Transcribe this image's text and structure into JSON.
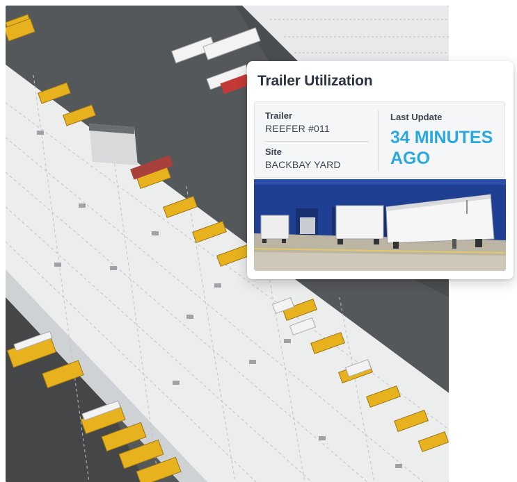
{
  "card": {
    "title": "Trailer Utilization",
    "trailer_label": "Trailer",
    "trailer_value": "REEFER #011",
    "site_label": "Site",
    "site_value": "BACKBAY YARD",
    "last_update_label": "Last Update",
    "last_update_line1": "34 MINUTES",
    "last_update_line2": "AGO"
  },
  "colors": {
    "accent": "#2aa8e0",
    "title_text": "#2b3440",
    "trailer_yellow": "#e7b21e",
    "warehouse_blue": "#1f3f93"
  },
  "images": {
    "background": "aerial-warehouse-photo",
    "card": "loading-dock-trailers-photo"
  }
}
